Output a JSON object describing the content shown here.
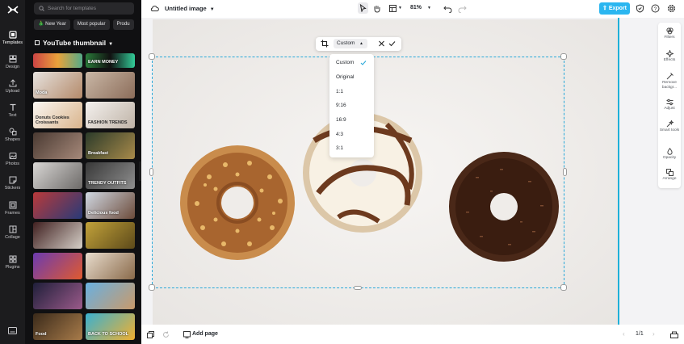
{
  "rail": {
    "items": [
      {
        "label": "Templates",
        "icon": "templates-icon"
      },
      {
        "label": "Design",
        "icon": "design-icon"
      },
      {
        "label": "Upload",
        "icon": "upload-icon"
      },
      {
        "label": "Text",
        "icon": "text-icon"
      },
      {
        "label": "Shapes",
        "icon": "shapes-icon"
      },
      {
        "label": "Photos",
        "icon": "photos-icon"
      },
      {
        "label": "Stickers",
        "icon": "stickers-icon"
      },
      {
        "label": "Frames",
        "icon": "frames-icon"
      },
      {
        "label": "Collage",
        "icon": "collage-icon"
      },
      {
        "label": "Plugins",
        "icon": "plugins-icon"
      }
    ]
  },
  "panel": {
    "search_placeholder": "Search for templates",
    "chips": [
      "New Year",
      "Most popular",
      "Produ"
    ],
    "title": "YouTube thumbnail",
    "thumb_texts": [
      "",
      "EARN MONEY",
      "Moda",
      "",
      "Donuts Cookies Croissants",
      "FASHION TRENDS",
      "",
      "Breakfast",
      "",
      "TRENDY OUTFITS",
      "",
      "Delicious food",
      "",
      "",
      "",
      "",
      "",
      "",
      "Vlog",
      "",
      "",
      "",
      "Food",
      "BACK TO SCHOOL"
    ]
  },
  "topbar": {
    "title": "Untitled image",
    "zoom": "81%",
    "export_label": "Export"
  },
  "crop": {
    "selected": "Custom",
    "options": [
      "Custom",
      "Original",
      "1:1",
      "9:16",
      "16:9",
      "4:3",
      "3:1"
    ]
  },
  "right_tools": [
    {
      "label": "Filters",
      "icon": "filters-icon"
    },
    {
      "label": "Effects",
      "icon": "effects-icon"
    },
    {
      "label": "Remove backgr...",
      "icon": "remove-background-icon"
    },
    {
      "label": "Adjust",
      "icon": "adjust-icon"
    },
    {
      "label": "Smart tools",
      "icon": "smart-tools-icon"
    },
    {
      "label": "Opacity",
      "icon": "opacity-icon"
    },
    {
      "label": "Arrange",
      "icon": "arrange-icon"
    }
  ],
  "bottombar": {
    "add_page": "Add page",
    "page_indicator": "1/1"
  },
  "colors": {
    "accent": "#2bb6f0",
    "selection": "#2aa9d9",
    "rail_bg": "#1c1c1e",
    "panel_bg": "#101012"
  }
}
